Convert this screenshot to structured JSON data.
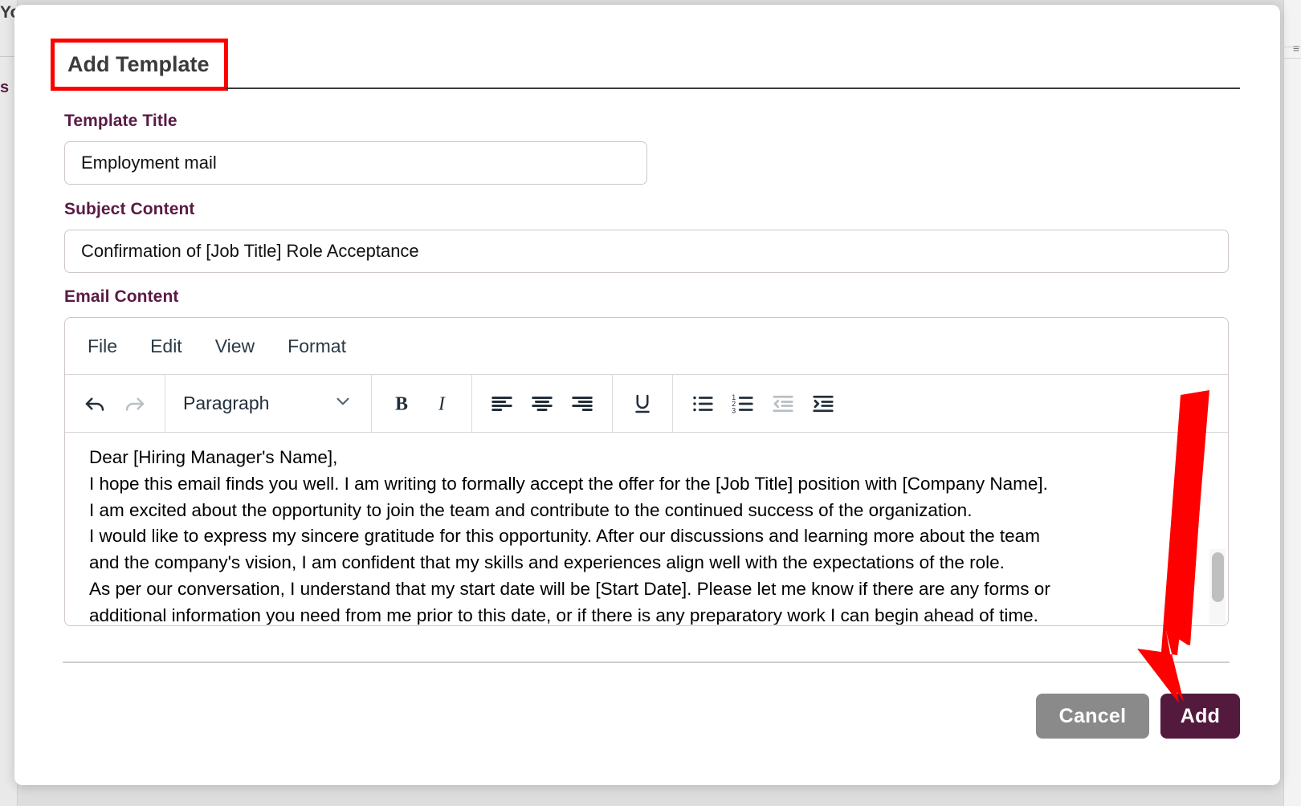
{
  "background": {
    "fragment_top": "Yo",
    "fragment_mid": "s",
    "right_glyph": "≡"
  },
  "modal": {
    "title": "Add Template",
    "fields": {
      "template_title": {
        "label": "Template Title",
        "value": "Employment mail",
        "placeholder": "Template Title"
      },
      "subject_content": {
        "label": "Subject Content",
        "value": "Confirmation of [Job Title] Role Acceptance",
        "placeholder": "Subject Content"
      },
      "email_content": {
        "label": "Email Content"
      }
    },
    "editor": {
      "menus": [
        "File",
        "Edit",
        "View",
        "Format"
      ],
      "format_select": {
        "value": "Paragraph",
        "chevron": "chevron-down-icon"
      },
      "toolbar_groups": [
        {
          "buttons": [
            {
              "name": "undo-icon",
              "title": "Undo",
              "enabled": true
            },
            {
              "name": "redo-icon",
              "title": "Redo",
              "enabled": false
            }
          ]
        },
        {
          "buttons": [
            {
              "name": "bold-icon",
              "title": "Bold",
              "enabled": true
            },
            {
              "name": "italic-icon",
              "title": "Italic",
              "enabled": true
            }
          ]
        },
        {
          "buttons": [
            {
              "name": "align-left-icon",
              "title": "Align left",
              "enabled": true
            },
            {
              "name": "align-center-icon",
              "title": "Align center",
              "enabled": true
            },
            {
              "name": "align-right-icon",
              "title": "Align right",
              "enabled": true
            }
          ]
        },
        {
          "buttons": [
            {
              "name": "underline-icon",
              "title": "Underline",
              "enabled": true
            }
          ]
        },
        {
          "buttons": [
            {
              "name": "bullet-list-icon",
              "title": "Bullet list",
              "enabled": true
            },
            {
              "name": "numbered-list-icon",
              "title": "Numbered list",
              "enabled": true
            },
            {
              "name": "outdent-icon",
              "title": "Decrease indent",
              "enabled": false
            },
            {
              "name": "indent-icon",
              "title": "Increase indent",
              "enabled": true
            }
          ]
        }
      ],
      "content_lines": [
        "Dear [Hiring Manager's Name],",
        "I hope this email finds you well. I am writing to formally accept the offer for the [Job Title] position with [Company Name].",
        "I am excited about the opportunity to join the team and contribute to the continued success of the organization.",
        "I would like to express my sincere gratitude for this opportunity. After our discussions and learning more about the team",
        "and the company's vision, I am confident that my skills and experiences align well with the expectations of the role.",
        "As per our conversation, I understand that my start date will be [Start Date]. Please let me know if there are any forms or",
        "additional information you need from me prior to this date, or if there is any preparatory work I can begin ahead of time."
      ]
    },
    "footer": {
      "cancel_label": "Cancel",
      "add_label": "Add"
    }
  },
  "annotations": {
    "title_highlight_color": "#ff0000",
    "arrow_color": "#ff0000",
    "arrow_points_to": "Add"
  },
  "colors": {
    "label_purple": "#5a1a44",
    "add_button": "#541a3e",
    "cancel_button": "#8a8a8a",
    "modal_background": "#ffffff",
    "page_background": "#dddddd"
  }
}
